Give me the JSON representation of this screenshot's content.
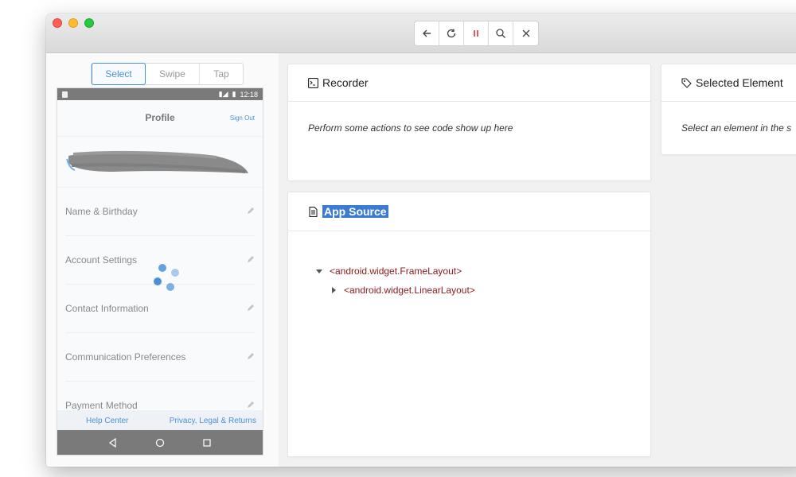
{
  "toolbar": {
    "buttons": [
      {
        "name": "back",
        "icon": "arrow-left-icon"
      },
      {
        "name": "refresh",
        "icon": "refresh-icon"
      },
      {
        "name": "pause",
        "icon": "pause-icon",
        "color": "#d0021b"
      },
      {
        "name": "search",
        "icon": "search-icon"
      },
      {
        "name": "close",
        "icon": "close-icon"
      }
    ]
  },
  "modes": {
    "select": "Select",
    "swipe": "Swipe",
    "tap": "Tap",
    "active": "select"
  },
  "device": {
    "status_time": "12:18",
    "header_title": "Profile",
    "sign_out": "Sign Out",
    "menu": [
      {
        "label": "Name & Birthday"
      },
      {
        "label": "Account Settings"
      },
      {
        "label": "Contact Information"
      },
      {
        "label": "Communication Preferences"
      },
      {
        "label": "Payment Method"
      }
    ],
    "footer": {
      "help": "Help Center",
      "privacy": "Privacy, Legal & Returns"
    }
  },
  "recorder": {
    "title": "Recorder",
    "empty_text": "Perform some actions to see code show up here"
  },
  "selected_element": {
    "title": "Selected Element",
    "empty_text": "Select an element in the s"
  },
  "app_source": {
    "title": "App Source",
    "tree": [
      {
        "label": "<android.widget.FrameLayout>",
        "expanded": true
      },
      {
        "label": "<android.widget.LinearLayout>",
        "expanded": false
      }
    ]
  },
  "colors": {
    "accent": "#4a90d9",
    "highlight": "#3b7bd4",
    "tag": "#8b1a1a"
  }
}
